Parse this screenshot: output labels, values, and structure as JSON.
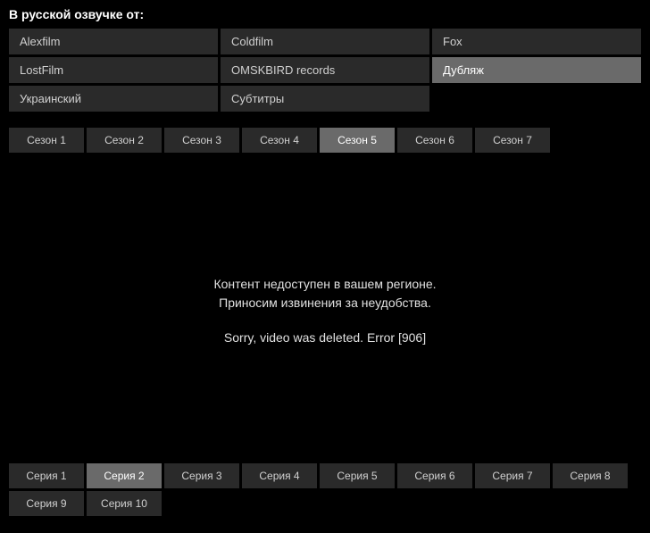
{
  "heading": "В русской озвучке от:",
  "voiceovers": [
    {
      "label": "Alexfilm",
      "active": false
    },
    {
      "label": "Coldfilm",
      "active": false
    },
    {
      "label": "Fox",
      "active": false
    },
    {
      "label": "LostFilm",
      "active": false
    },
    {
      "label": "OMSKBIRD records",
      "active": false
    },
    {
      "label": "Дубляж",
      "active": true
    },
    {
      "label": "Украинский",
      "active": false
    },
    {
      "label": "Субтитры",
      "active": false
    }
  ],
  "seasons": [
    {
      "label": "Сезон 1",
      "active": false
    },
    {
      "label": "Сезон 2",
      "active": false
    },
    {
      "label": "Сезон 3",
      "active": false
    },
    {
      "label": "Сезон 4",
      "active": false
    },
    {
      "label": "Сезон 5",
      "active": true
    },
    {
      "label": "Сезон 6",
      "active": false
    },
    {
      "label": "Сезон 7",
      "active": false
    }
  ],
  "player": {
    "msg1": "Контент недоступен в вашем регионе.",
    "msg2": "Приносим извинения за неудобства.",
    "msg3": "Sorry, video was deleted. Error [906]"
  },
  "episodes": [
    {
      "label": "Серия 1",
      "active": false
    },
    {
      "label": "Серия 2",
      "active": true
    },
    {
      "label": "Серия 3",
      "active": false
    },
    {
      "label": "Серия 4",
      "active": false
    },
    {
      "label": "Серия 5",
      "active": false
    },
    {
      "label": "Серия 6",
      "active": false
    },
    {
      "label": "Серия 7",
      "active": false
    },
    {
      "label": "Серия 8",
      "active": false
    },
    {
      "label": "Серия 9",
      "active": false
    },
    {
      "label": "Серия 10",
      "active": false
    }
  ]
}
